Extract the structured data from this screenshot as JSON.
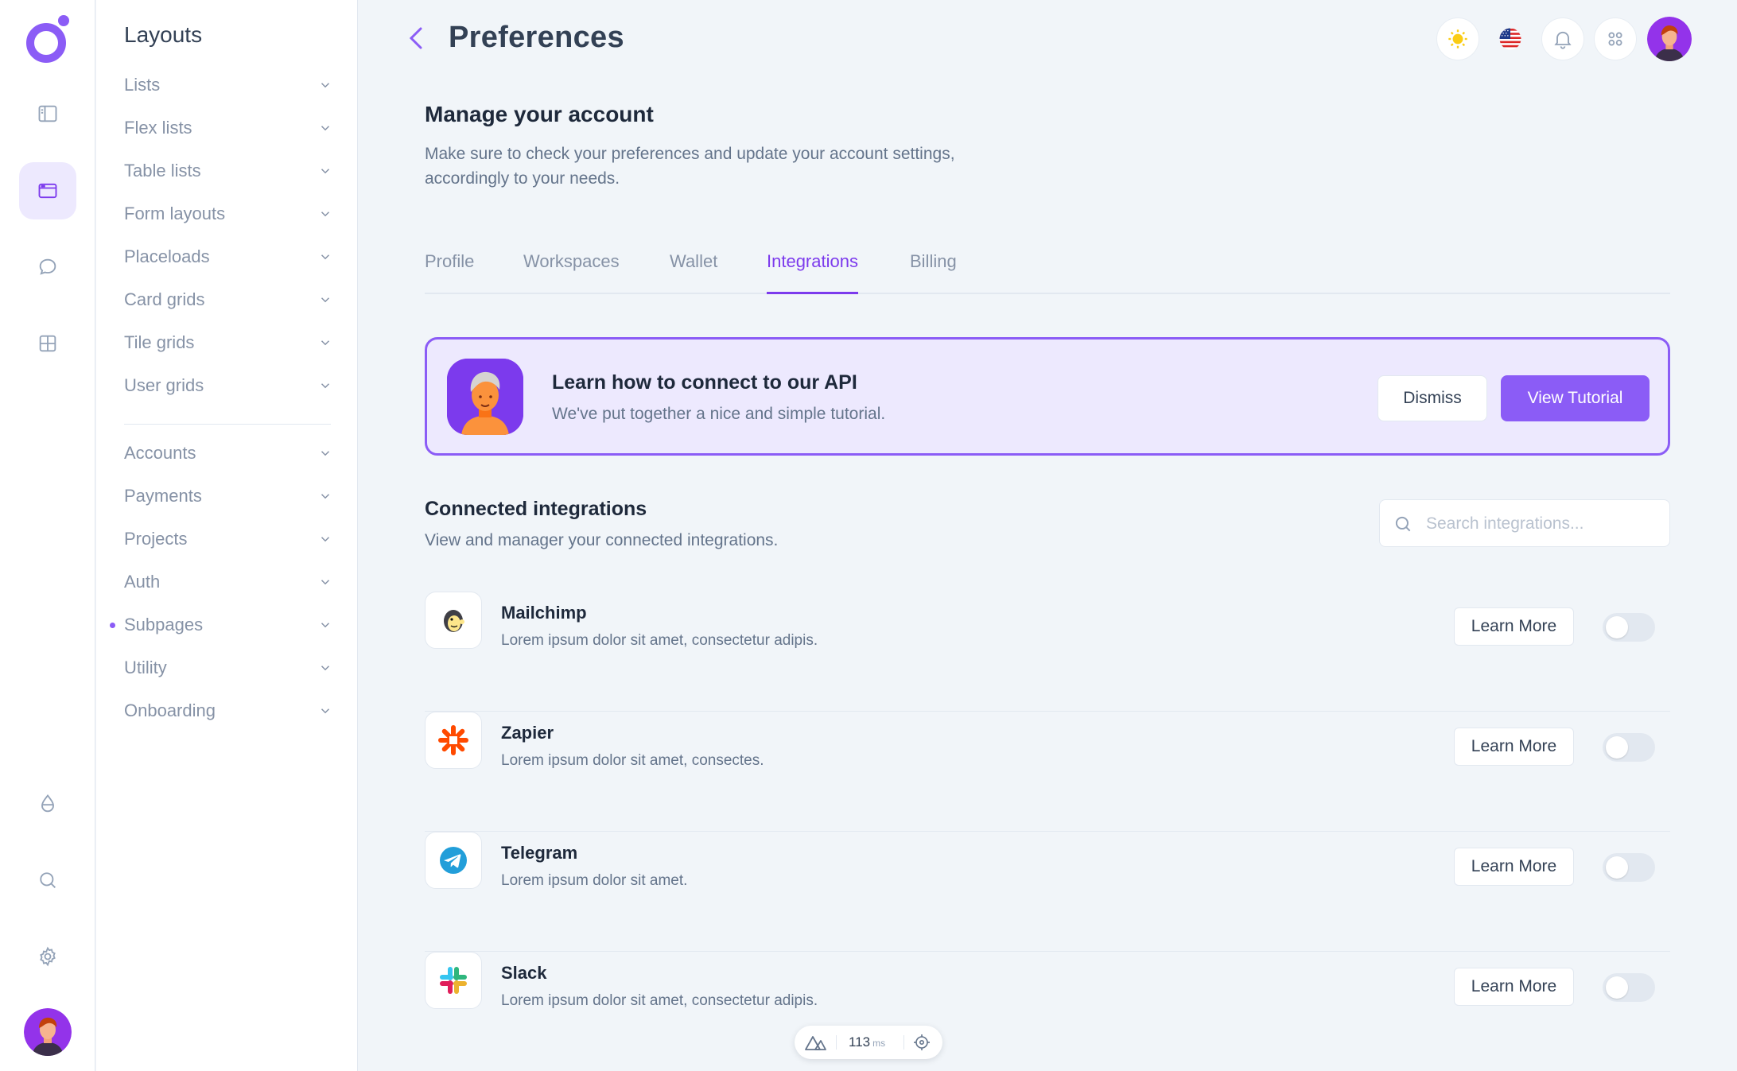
{
  "app": {
    "brand_color": "#8b5cf6"
  },
  "rail": {
    "top_icons": [
      "sidebar-toggle-icon",
      "layout-icon",
      "chat-icon",
      "grid-icon"
    ],
    "active_index": 1,
    "bottom_icons": [
      "drop-icon",
      "search-icon",
      "gear-icon"
    ]
  },
  "submenu": {
    "title": "Layouts",
    "group1": [
      {
        "label": "Lists"
      },
      {
        "label": "Flex lists"
      },
      {
        "label": "Table lists"
      },
      {
        "label": "Form layouts"
      },
      {
        "label": "Placeloads"
      },
      {
        "label": "Card grids"
      },
      {
        "label": "Tile grids"
      },
      {
        "label": "User grids"
      }
    ],
    "group2": [
      {
        "label": "Accounts"
      },
      {
        "label": "Payments"
      },
      {
        "label": "Projects"
      },
      {
        "label": "Auth"
      },
      {
        "label": "Subpages",
        "active": true
      },
      {
        "label": "Utility"
      },
      {
        "label": "Onboarding"
      }
    ]
  },
  "header": {
    "title": "Preferences",
    "actions": [
      "sun-icon",
      "us-flag-icon",
      "bell-icon",
      "apps-icon",
      "user-avatar"
    ]
  },
  "account": {
    "title": "Manage your account",
    "description": "Make sure to check your preferences and update your account settings, accordingly to your needs."
  },
  "tabs": [
    {
      "label": "Profile"
    },
    {
      "label": "Workspaces"
    },
    {
      "label": "Wallet"
    },
    {
      "label": "Integrations",
      "active": true
    },
    {
      "label": "Billing"
    }
  ],
  "banner": {
    "title": "Learn how to connect to our API",
    "description": "We've put together a nice and simple tutorial.",
    "dismiss_label": "Dismiss",
    "view_label": "View Tutorial"
  },
  "integrations": {
    "title": "Connected integrations",
    "description": "View and manager your connected integrations.",
    "search_placeholder": "Search integrations...",
    "learn_more_label": "Learn More",
    "items": [
      {
        "name": "Mailchimp",
        "description": "Lorem ipsum dolor sit amet, consectetur adipis.",
        "icon": "mailchimp-icon",
        "enabled": false
      },
      {
        "name": "Zapier",
        "description": "Lorem ipsum dolor sit amet, consectes.",
        "icon": "zapier-icon",
        "enabled": false
      },
      {
        "name": "Telegram",
        "description": "Lorem ipsum dolor sit amet.",
        "icon": "telegram-icon",
        "enabled": false
      },
      {
        "name": "Slack",
        "description": "Lorem ipsum dolor sit amet, consectetur adipis.",
        "icon": "slack-icon",
        "enabled": false
      }
    ]
  },
  "devtools": {
    "timing": "113",
    "unit": "ms"
  }
}
